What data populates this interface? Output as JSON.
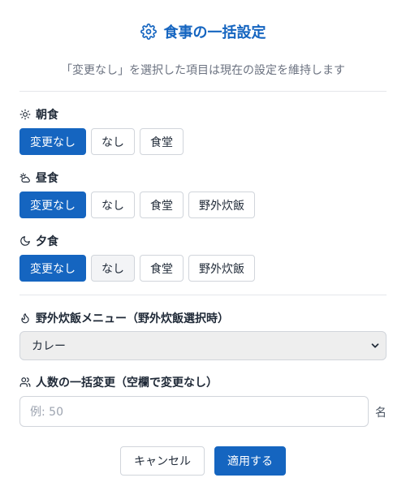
{
  "dialog": {
    "title": "食事の一括設定",
    "note": "「変更なし」を選択した項目は現在の設定を維持します"
  },
  "meals": [
    {
      "label": "朝食",
      "icon": "sun-icon",
      "options": [
        "変更なし",
        "なし",
        "食堂"
      ],
      "selected": "変更なし"
    },
    {
      "label": "昼食",
      "icon": "sun-cloud-icon",
      "options": [
        "変更なし",
        "なし",
        "食堂",
        "野外炊飯"
      ],
      "selected": "変更なし"
    },
    {
      "label": "夕食",
      "icon": "moon-icon",
      "options": [
        "変更なし",
        "なし",
        "食堂",
        "野外炊飯"
      ],
      "selected": "変更なし"
    }
  ],
  "menu": {
    "label": "野外炊飯メニュー（野外炊飯選択時）",
    "icon": "flame-icon",
    "value": "カレー"
  },
  "people": {
    "label": "人数の一括変更（空欄で変更なし）",
    "icon": "users-icon",
    "placeholder": "例: 50",
    "unit": "名"
  },
  "footer": {
    "cancel": "キャンセル",
    "apply": "適用する"
  },
  "colors": {
    "accent": "#1565c0",
    "border": "#d1d5db",
    "muted": "#6b7280"
  }
}
